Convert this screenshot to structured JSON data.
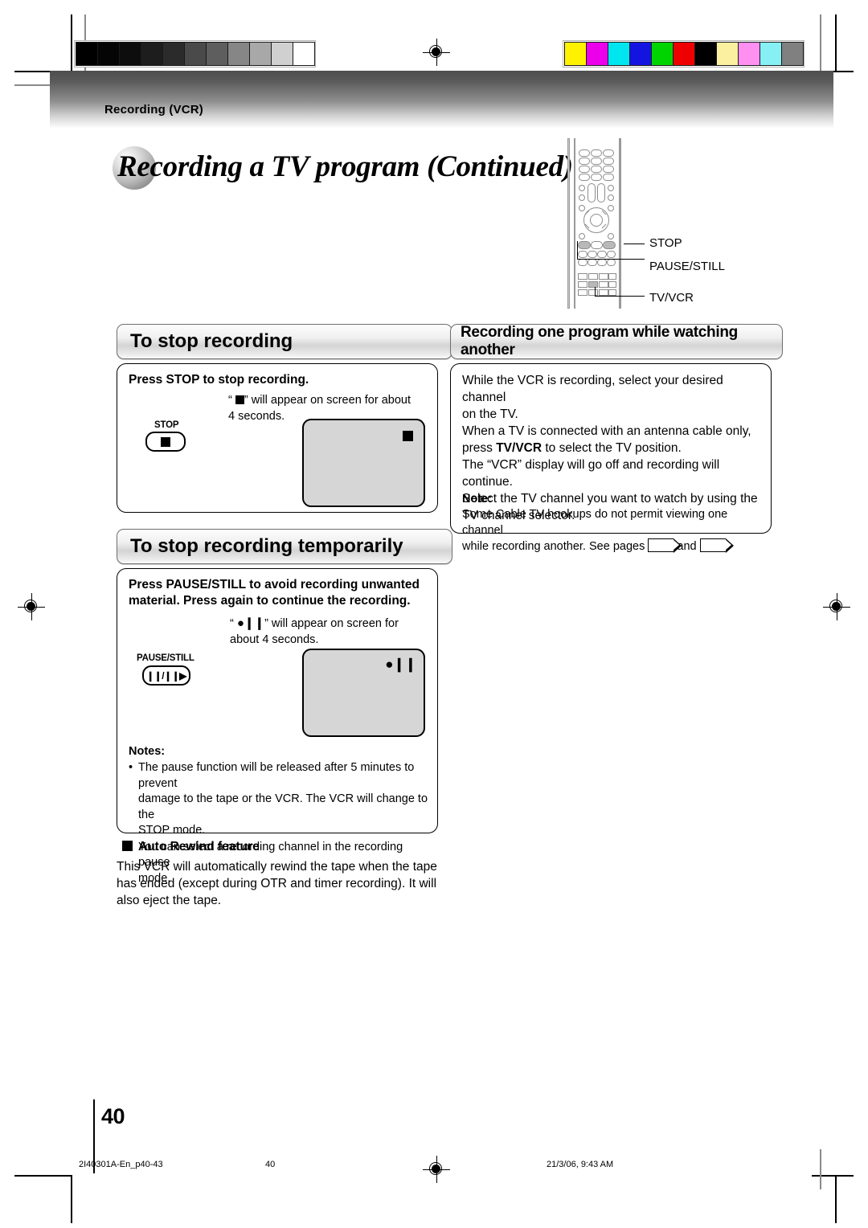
{
  "header": {
    "section_label": "Recording (VCR)",
    "page_title": "Recording a TV program (Continued)"
  },
  "remote": {
    "callouts": [
      "STOP",
      "PAUSE/STILL",
      "TV/VCR"
    ]
  },
  "sections": [
    {
      "id": "stop-recording",
      "heading": "To stop recording",
      "bold_instruction": "Press STOP to stop recording.",
      "note_prefix": "“",
      "note_suffix": "” will appear on screen for about",
      "note_line2": "4 seconds.",
      "key_label": "STOP",
      "osd_glyph": "stop-square"
    },
    {
      "id": "stop-recording-temporarily",
      "heading": "To stop recording temporarily",
      "bold_line1": "Press PAUSE/STILL to avoid recording unwanted",
      "bold_line2": "material. Press again to continue the recording.",
      "note_prefix": "“",
      "note_glyph": "●❙❙",
      "note_suffix": "” will appear on screen for",
      "note_line2": "about 4 seconds.",
      "key_label": "PAUSE/STILL",
      "key_glyph": "❙❙/❙❙▶",
      "osd_glyph": "●❙❙"
    }
  ],
  "right_panel": {
    "heading": "Recording one program while watching another",
    "paragraphs": [
      "While the VCR is recording, select your desired channel on the TV.",
      "When a TV is connected with an antenna cable only, press TV/VCR to select the TV position.",
      "The “VCR” display will go off and recording will continue. Select the TV channel you want to watch by using the TV channel selector."
    ],
    "lines": [
      "While the VCR is recording, select your desired channel",
      "on the TV.",
      "When a TV is connected with an antenna cable only,",
      "press ",
      "TV/VCR",
      " to select the TV position.",
      "The “VCR” display will go off and recording will continue.",
      "Select the TV channel you want to watch by using the",
      "TV channel selector."
    ],
    "note_heading": "Note:",
    "note_line1": "Some Cable TV hookups do not permit viewing one channel",
    "note_line2_a": "while recording another. See pages",
    "note_line2_b": "and",
    "note_line2_c": ".",
    "emphasis": "TV/VCR"
  },
  "notes_box": {
    "heading": "Notes:",
    "items": [
      "The pause function will be released after 5 minutes to prevent damage to the tape or the VCR. The VCR will change to the STOP mode.",
      "You can select a recording channel in the recording pause mode."
    ],
    "item1_lines": [
      "The pause function will be released after 5 minutes to prevent",
      "damage to the tape or the VCR. The VCR will change to the",
      "STOP mode."
    ],
    "item2_lines": [
      "You can select a recording channel in the recording pause",
      "mode."
    ]
  },
  "auto_rewind": {
    "heading": "Auto Rewind feature",
    "lines": [
      "This VCR will automatically rewind the tape when the tape",
      "has ended (except during OTR and timer recording). It will",
      "also eject the tape."
    ],
    "body": "This VCR will automatically rewind the tape when the tape has ended (except during OTR and timer recording). It will also eject the tape."
  },
  "footer": {
    "page_number": "40",
    "file_id": "2I40301A-En_p40-43",
    "center_number": "40",
    "timestamp": "21/3/06, 9:43 AM"
  },
  "calibration": {
    "gray_steps": [
      "#000000",
      "#050505",
      "#0d0d0d",
      "#1d1d1d",
      "#2b2b2b",
      "#4a4a4a",
      "#5e5e5e",
      "#868686",
      "#a8a8a8",
      "#d0d0d0",
      "#ffffff"
    ],
    "color_steps": [
      "#fff200",
      "#ec00ec",
      "#00e6f0",
      "#1414e0",
      "#00d400",
      "#ee0000",
      "#000000",
      "#fbf0a0",
      "#ff8ff0",
      "#86f0f5",
      "#808080"
    ]
  }
}
